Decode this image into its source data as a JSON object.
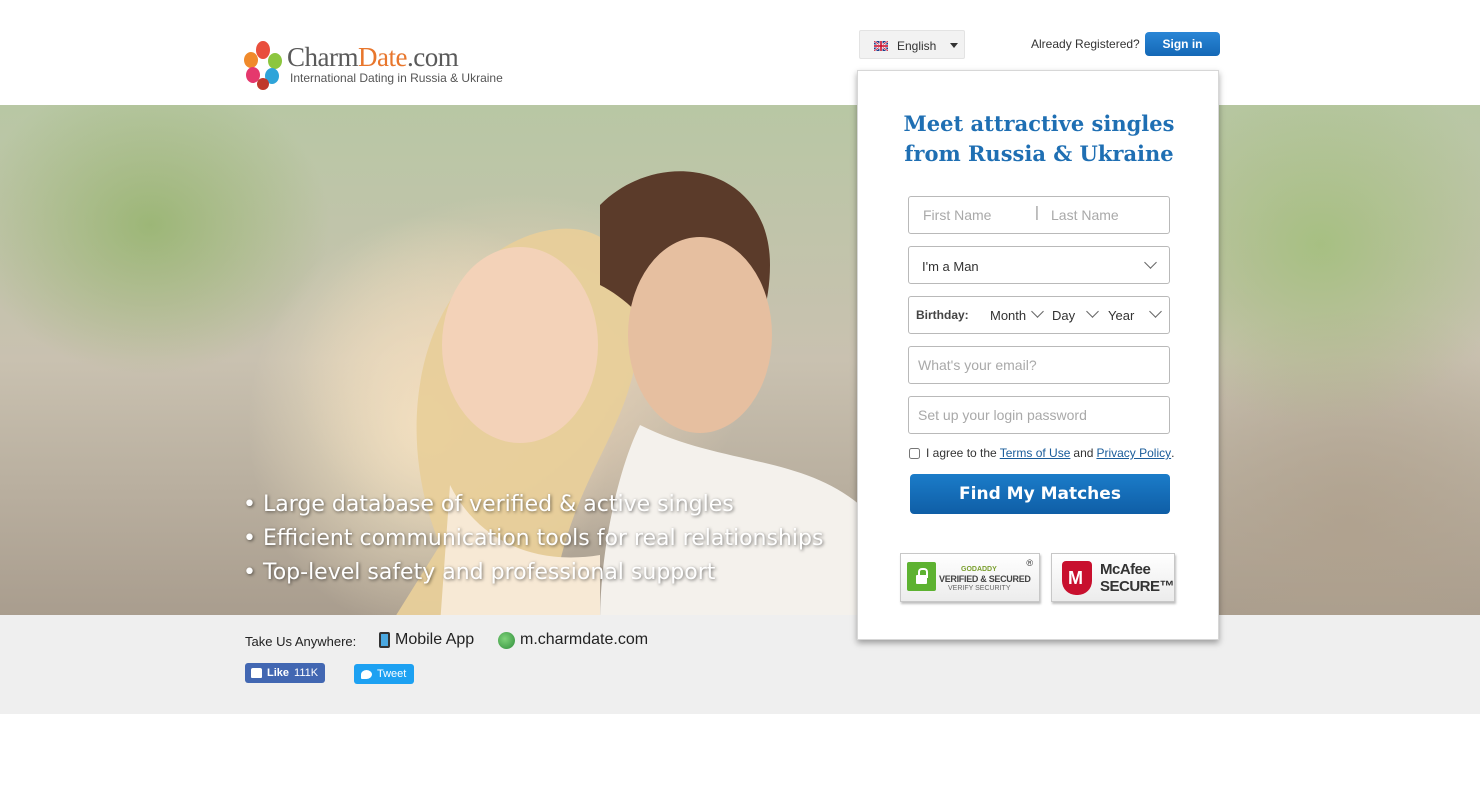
{
  "header": {
    "logo": {
      "name_main": "Charm",
      "name_accent": "Date",
      "name_suffix": ".com",
      "tagline": "International Dating in Russia & Ukraine"
    },
    "language": {
      "selected": "English",
      "icon": "uk-flag-icon"
    },
    "already_registered": "Already Registered?",
    "sign_in_label": "Sign in"
  },
  "hero": {
    "benefits": [
      "Large database of verified & active singles",
      "Efficient communication tools for real relationships",
      "Top-level safety and professional support"
    ]
  },
  "registration": {
    "title_line1": "Meet attractive singles",
    "title_line2": "from Russia & Ukraine",
    "first_name_placeholder": "First Name",
    "name_separator": "|",
    "last_name_placeholder": "Last Name",
    "gender_selected": "I'm a Man",
    "birthday_label": "Birthday:",
    "month_label": "Month",
    "day_label": "Day",
    "year_label": "Year",
    "email_placeholder": "What's your email?",
    "password_placeholder": "Set up your login password",
    "agree_prefix": "I agree to the",
    "terms_label": "Terms of Use",
    "agree_and": "and",
    "privacy_label": "Privacy Policy",
    "agree_suffix": ".",
    "submit_label": "Find My Matches",
    "badges": {
      "godaddy_line1": "GODADDY",
      "godaddy_line2": "VERIFIED & SECURED",
      "godaddy_line3": "VERIFY SECURITY",
      "godaddy_reg": "®",
      "mcafee_line1": "McAfee",
      "mcafee_line2": "SECURE™"
    }
  },
  "footer": {
    "take_us": "Take Us Anywhere:",
    "mobile_app": "Mobile App",
    "mobile_site": "m.charmdate.com",
    "like_label": "Like",
    "like_count": "111K",
    "tweet_label": "Tweet"
  },
  "colors": {
    "brand_blue": "#1f6fb3",
    "brand_orange": "#e8762c",
    "button_blue": "#1468b6"
  }
}
